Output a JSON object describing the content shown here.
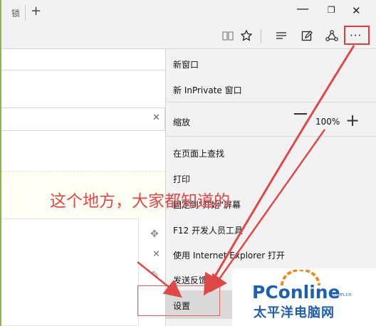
{
  "browser": {
    "tab_fragment": "锁",
    "new_tab_glyph": "+",
    "window_controls": {
      "minimize": "—",
      "maximize": "❐",
      "close": "✕"
    }
  },
  "toolbar": {
    "more_glyph": "···",
    "accent_color": "#e53a3a"
  },
  "menu": {
    "items": [
      {
        "label": "新窗口"
      },
      {
        "label": "新 InPrivate 窗口"
      },
      {
        "label": "缩放"
      },
      {
        "label": "在页面上查找"
      },
      {
        "label": "打印"
      },
      {
        "label": "固定到\"开始\"屏幕"
      },
      {
        "label": "F12 开发人员工具"
      },
      {
        "label": "使用 Internet Explorer 打开"
      },
      {
        "label": "发送反馈"
      },
      {
        "label": "设置"
      }
    ],
    "zoom": {
      "value": "100%",
      "plus": "+"
    }
  },
  "annotation": {
    "text": "这个地方，大家都知道的",
    "color": "#e04848"
  },
  "watermark": {
    "brand": "PConline",
    "domain": ".com.cn",
    "chinese": "太平洋电脑网"
  }
}
